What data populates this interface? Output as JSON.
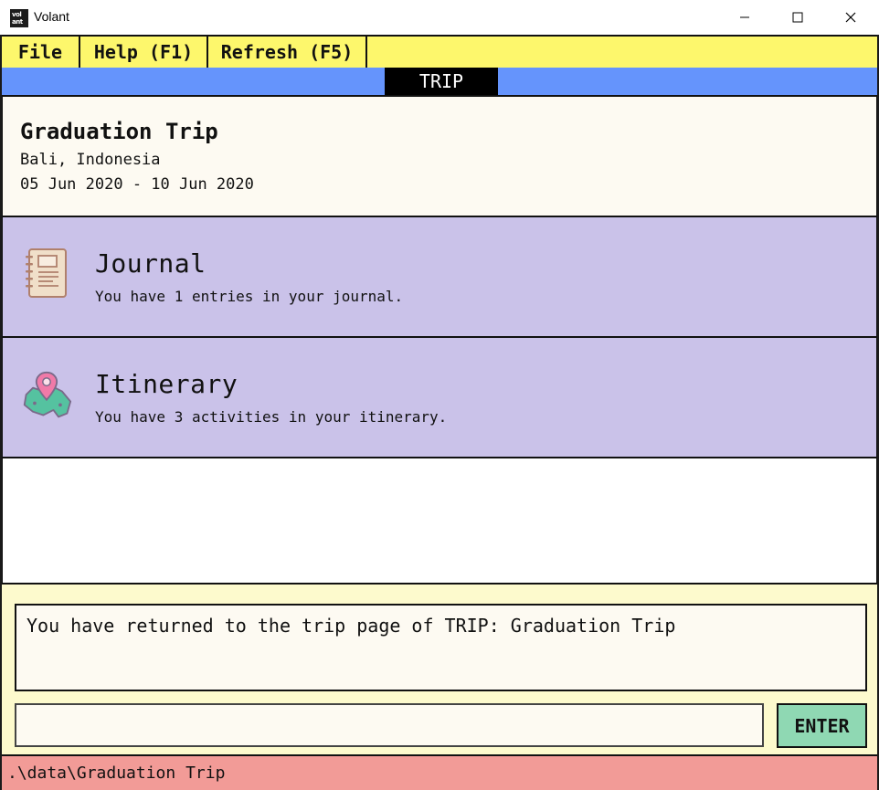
{
  "window": {
    "title": "Volant",
    "logo_line1": "vol",
    "logo_line2": "ant",
    "minimize_icon": "minimize-icon",
    "maximize_icon": "maximize-icon",
    "close_icon": "close-icon"
  },
  "menu": {
    "file": "File",
    "help": "Help (F1)",
    "refresh": "Refresh (F5)"
  },
  "tab": {
    "label": "TRIP"
  },
  "trip": {
    "name": "Graduation Trip",
    "location": "Bali, Indonesia",
    "dates": "05 Jun 2020 - 10 Jun 2020"
  },
  "cards": {
    "journal": {
      "icon": "notebook-icon",
      "title": "Journal",
      "description": "You have 1 entries in your journal."
    },
    "itinerary": {
      "icon": "map-pin-icon",
      "title": "Itinerary",
      "description": "You have 3 activities in your itinerary."
    }
  },
  "command": {
    "result": "You have returned to the trip page of TRIP: Graduation Trip",
    "input_value": "",
    "enter_label": "ENTER"
  },
  "status": {
    "path": ".\\data\\Graduation Trip"
  },
  "colors": {
    "menu_bg": "#fdf76c",
    "tab_bg": "#6594fc",
    "card_bg": "#cac2e9",
    "enter_bg": "#8fd8b3",
    "status_bg": "#f29b97"
  }
}
